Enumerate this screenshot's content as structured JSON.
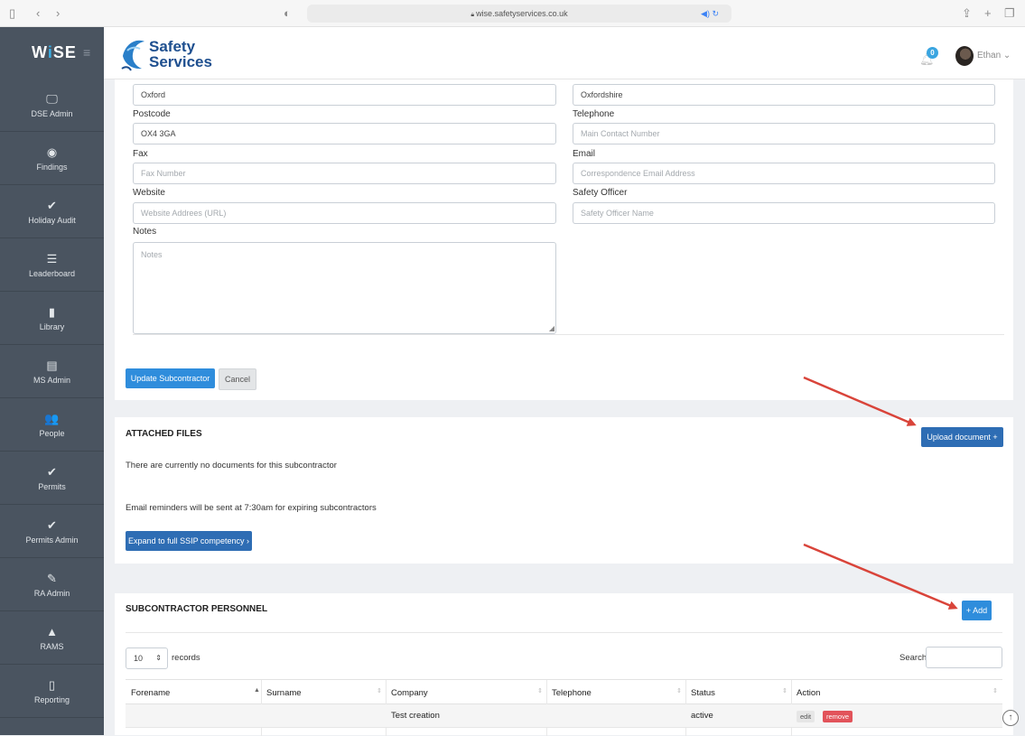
{
  "browser": {
    "url": "wise.safetyservices.co.uk"
  },
  "header": {
    "brand_prefix": "W",
    "brand_i": "i",
    "brand_suffix": "SE",
    "logo_line1": "Safety",
    "logo_line2": "Services",
    "notification_count": "0",
    "user_name": "Ethan ⌄"
  },
  "sidebar": {
    "items": [
      {
        "label": "DSE Admin",
        "icon": "🖵"
      },
      {
        "label": "Findings",
        "icon": "◉"
      },
      {
        "label": "Holiday Audit",
        "icon": "✔"
      },
      {
        "label": "Leaderboard",
        "icon": "☰"
      },
      {
        "label": "Library",
        "icon": "▮"
      },
      {
        "label": "MS Admin",
        "icon": "▤"
      },
      {
        "label": "People",
        "icon": "👥"
      },
      {
        "label": "Permits",
        "icon": "✔"
      },
      {
        "label": "Permits Admin",
        "icon": "✔"
      },
      {
        "label": "RA Admin",
        "icon": "✎"
      },
      {
        "label": "RAMS",
        "icon": "▲"
      },
      {
        "label": "Reporting",
        "icon": "▯"
      }
    ]
  },
  "form": {
    "city_value": "Oxford",
    "county_value": "Oxfordshire",
    "postcode_label": "Postcode",
    "postcode_value": "OX4 3GA",
    "telephone_label": "Telephone",
    "telephone_placeholder": "Main Contact Number",
    "fax_label": "Fax",
    "fax_placeholder": "Fax Number",
    "email_label": "Email",
    "email_placeholder": "Correspondence Email Address",
    "website_label": "Website",
    "website_placeholder": "Website Addrees (URL)",
    "safety_officer_label": "Safety Officer",
    "safety_officer_placeholder": "Safety Officer Name",
    "notes_label": "Notes",
    "notes_placeholder": "Notes",
    "update_button": "Update Subcontractor",
    "cancel_button": "Cancel"
  },
  "attached_files": {
    "heading": "ATTACHED FILES",
    "upload_button": "Upload document +",
    "empty_text": "There are currently no documents for this subcontractor",
    "reminder_text": "Email reminders will be sent at 7:30am for expiring subcontractors",
    "expand_button": "Expand to full SSIP competency ›"
  },
  "personnel": {
    "heading": "SUBCONTRACTOR PERSONNEL",
    "add_button": "+ Add",
    "records_value": "10",
    "records_label": "records",
    "search_label": "Search:",
    "columns": [
      "Forename",
      "Surname",
      "Company",
      "Telephone",
      "Status",
      "Action"
    ],
    "rows": [
      {
        "forename": "",
        "surname": "",
        "company": "Test creation",
        "telephone": "",
        "status": "active",
        "edit": "edit",
        "remove": "remove"
      }
    ]
  },
  "colors": {
    "sidebar": "#4a5460",
    "primary": "#2f8ddc",
    "danger": "#e2535a",
    "arrow": "#d9443a"
  }
}
